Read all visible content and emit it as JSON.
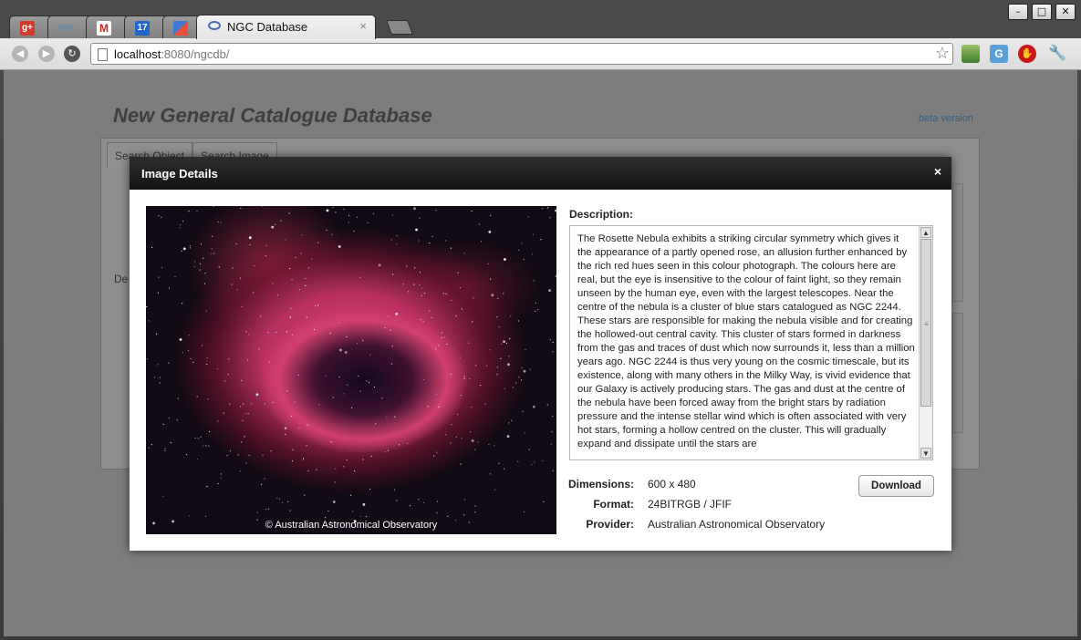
{
  "browser": {
    "tabs": [
      {
        "icon": "google-plus-icon"
      },
      {
        "icon": "imo-icon",
        "label": "imo"
      },
      {
        "icon": "gmail-icon"
      },
      {
        "icon": "calendar-icon",
        "label": "17"
      },
      {
        "icon": "analytics-icon"
      },
      {
        "icon": "planet-icon",
        "label": "NGC Database",
        "active": true,
        "close": "×"
      }
    ],
    "window_controls": [
      "–",
      "□",
      "✕"
    ],
    "url_host": "localhost",
    "url_rest": ":8080/ngcdb/"
  },
  "page": {
    "title": "New General Catalogue Database",
    "beta_label": "beta version",
    "tabs": [
      "Search Object",
      "Search Image"
    ],
    "side_label": "De"
  },
  "modal": {
    "title": "Image Details",
    "close": "×",
    "photo_credit": "© Australian Astronomical Observatory",
    "description_label": "Description:",
    "description": "The Rosette Nebula exhibits a striking circular symmetry which gives it the appearance of a partly opened rose, an allusion further enhanced by the rich red hues seen in this colour photograph. The colours here are real, but the eye is insensitive to the colour of faint light, so they remain unseen by the human eye, even with the largest telescopes. Near the centre of the nebula is a cluster of blue stars catalogued as NGC 2244. These stars are responsible for making the nebula visible and for creating the hollowed-out central cavity. This cluster of stars formed in darkness from the gas and traces of dust which now surrounds it, less than a million years ago. NGC 2244 is thus very young on the cosmic timescale, but its existence, along with many others in the Milky Way, is vivid evidence that our Galaxy is actively producing stars. The gas and dust at the centre of the nebula have been forced away from the bright stars by radiation pressure and the intense stellar wind which is often associated with very hot stars, forming a hollow centred on the cluster. This will gradually expand and dissipate until the stars are",
    "dimensions_label": "Dimensions:",
    "dimensions": "600 x 480",
    "format_label": "Format:",
    "format": "24BITRGB / JFIF",
    "provider_label": "Provider:",
    "provider": "Australian Astronomical Observatory",
    "download_label": "Download"
  }
}
